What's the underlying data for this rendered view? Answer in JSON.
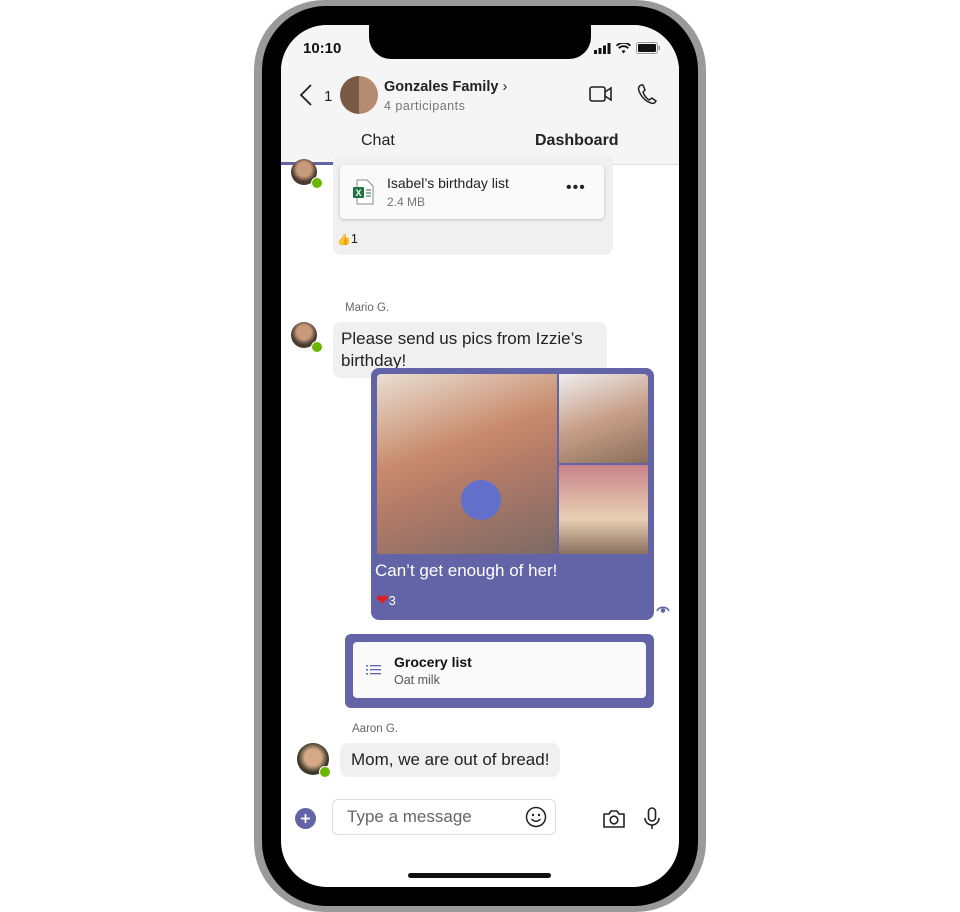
{
  "status_bar": {
    "time": "10:10"
  },
  "header": {
    "back_count": "1",
    "title": "Gonzales Family",
    "title_chevron": "›",
    "subtitle": "4 participants",
    "video_icon": "video-camera-icon",
    "call_icon": "phone-icon"
  },
  "tabs": [
    {
      "label": "Chat",
      "active": true
    },
    {
      "label": "Dashboard",
      "active": false
    }
  ],
  "messages": [
    {
      "type": "file",
      "file_name": "Isabel’s birthday list",
      "file_size": "2.4 MB",
      "more_label": "•••",
      "reaction": {
        "emoji": "👍",
        "count": "1"
      }
    },
    {
      "type": "text",
      "sender": "Mario G.",
      "text": "Please send us pics from Izzie’s birthday!"
    },
    {
      "type": "photos",
      "caption": "Can’t get enough of her!",
      "reaction": {
        "emoji": "❤",
        "count": "3"
      },
      "read_icon": "eye-icon"
    },
    {
      "type": "card",
      "title": "Grocery list",
      "subtitle": "Oat milk"
    },
    {
      "type": "text",
      "sender": "Aaron G.",
      "text": "Mom, we are out of bread!"
    }
  ],
  "compose": {
    "placeholder": "Type a message",
    "add_icon": "plus-icon",
    "emoji_icon": "emoji-icon",
    "camera_icon": "camera-icon",
    "mic_icon": "microphone-icon"
  },
  "colors": {
    "accent": "#6264a7",
    "presence": "#6bb700",
    "heart": "#e02020"
  }
}
